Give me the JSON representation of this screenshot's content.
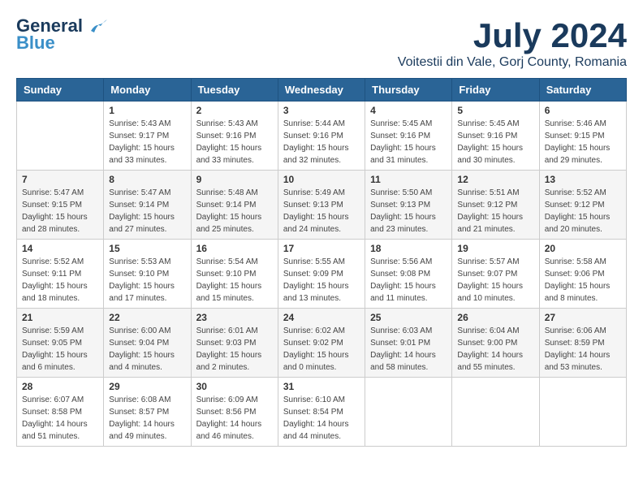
{
  "header": {
    "logo_line1": "General",
    "logo_line2": "Blue",
    "month": "July 2024",
    "location": "Voitestii din Vale, Gorj County, Romania"
  },
  "weekdays": [
    "Sunday",
    "Monday",
    "Tuesday",
    "Wednesday",
    "Thursday",
    "Friday",
    "Saturday"
  ],
  "weeks": [
    [
      {
        "day": "",
        "sunrise": "",
        "sunset": "",
        "daylight": ""
      },
      {
        "day": "1",
        "sunrise": "Sunrise: 5:43 AM",
        "sunset": "Sunset: 9:17 PM",
        "daylight": "Daylight: 15 hours and 33 minutes."
      },
      {
        "day": "2",
        "sunrise": "Sunrise: 5:43 AM",
        "sunset": "Sunset: 9:16 PM",
        "daylight": "Daylight: 15 hours and 33 minutes."
      },
      {
        "day": "3",
        "sunrise": "Sunrise: 5:44 AM",
        "sunset": "Sunset: 9:16 PM",
        "daylight": "Daylight: 15 hours and 32 minutes."
      },
      {
        "day": "4",
        "sunrise": "Sunrise: 5:45 AM",
        "sunset": "Sunset: 9:16 PM",
        "daylight": "Daylight: 15 hours and 31 minutes."
      },
      {
        "day": "5",
        "sunrise": "Sunrise: 5:45 AM",
        "sunset": "Sunset: 9:16 PM",
        "daylight": "Daylight: 15 hours and 30 minutes."
      },
      {
        "day": "6",
        "sunrise": "Sunrise: 5:46 AM",
        "sunset": "Sunset: 9:15 PM",
        "daylight": "Daylight: 15 hours and 29 minutes."
      }
    ],
    [
      {
        "day": "7",
        "sunrise": "Sunrise: 5:47 AM",
        "sunset": "Sunset: 9:15 PM",
        "daylight": "Daylight: 15 hours and 28 minutes."
      },
      {
        "day": "8",
        "sunrise": "Sunrise: 5:47 AM",
        "sunset": "Sunset: 9:14 PM",
        "daylight": "Daylight: 15 hours and 27 minutes."
      },
      {
        "day": "9",
        "sunrise": "Sunrise: 5:48 AM",
        "sunset": "Sunset: 9:14 PM",
        "daylight": "Daylight: 15 hours and 25 minutes."
      },
      {
        "day": "10",
        "sunrise": "Sunrise: 5:49 AM",
        "sunset": "Sunset: 9:13 PM",
        "daylight": "Daylight: 15 hours and 24 minutes."
      },
      {
        "day": "11",
        "sunrise": "Sunrise: 5:50 AM",
        "sunset": "Sunset: 9:13 PM",
        "daylight": "Daylight: 15 hours and 23 minutes."
      },
      {
        "day": "12",
        "sunrise": "Sunrise: 5:51 AM",
        "sunset": "Sunset: 9:12 PM",
        "daylight": "Daylight: 15 hours and 21 minutes."
      },
      {
        "day": "13",
        "sunrise": "Sunrise: 5:52 AM",
        "sunset": "Sunset: 9:12 PM",
        "daylight": "Daylight: 15 hours and 20 minutes."
      }
    ],
    [
      {
        "day": "14",
        "sunrise": "Sunrise: 5:52 AM",
        "sunset": "Sunset: 9:11 PM",
        "daylight": "Daylight: 15 hours and 18 minutes."
      },
      {
        "day": "15",
        "sunrise": "Sunrise: 5:53 AM",
        "sunset": "Sunset: 9:10 PM",
        "daylight": "Daylight: 15 hours and 17 minutes."
      },
      {
        "day": "16",
        "sunrise": "Sunrise: 5:54 AM",
        "sunset": "Sunset: 9:10 PM",
        "daylight": "Daylight: 15 hours and 15 minutes."
      },
      {
        "day": "17",
        "sunrise": "Sunrise: 5:55 AM",
        "sunset": "Sunset: 9:09 PM",
        "daylight": "Daylight: 15 hours and 13 minutes."
      },
      {
        "day": "18",
        "sunrise": "Sunrise: 5:56 AM",
        "sunset": "Sunset: 9:08 PM",
        "daylight": "Daylight: 15 hours and 11 minutes."
      },
      {
        "day": "19",
        "sunrise": "Sunrise: 5:57 AM",
        "sunset": "Sunset: 9:07 PM",
        "daylight": "Daylight: 15 hours and 10 minutes."
      },
      {
        "day": "20",
        "sunrise": "Sunrise: 5:58 AM",
        "sunset": "Sunset: 9:06 PM",
        "daylight": "Daylight: 15 hours and 8 minutes."
      }
    ],
    [
      {
        "day": "21",
        "sunrise": "Sunrise: 5:59 AM",
        "sunset": "Sunset: 9:05 PM",
        "daylight": "Daylight: 15 hours and 6 minutes."
      },
      {
        "day": "22",
        "sunrise": "Sunrise: 6:00 AM",
        "sunset": "Sunset: 9:04 PM",
        "daylight": "Daylight: 15 hours and 4 minutes."
      },
      {
        "day": "23",
        "sunrise": "Sunrise: 6:01 AM",
        "sunset": "Sunset: 9:03 PM",
        "daylight": "Daylight: 15 hours and 2 minutes."
      },
      {
        "day": "24",
        "sunrise": "Sunrise: 6:02 AM",
        "sunset": "Sunset: 9:02 PM",
        "daylight": "Daylight: 15 hours and 0 minutes."
      },
      {
        "day": "25",
        "sunrise": "Sunrise: 6:03 AM",
        "sunset": "Sunset: 9:01 PM",
        "daylight": "Daylight: 14 hours and 58 minutes."
      },
      {
        "day": "26",
        "sunrise": "Sunrise: 6:04 AM",
        "sunset": "Sunset: 9:00 PM",
        "daylight": "Daylight: 14 hours and 55 minutes."
      },
      {
        "day": "27",
        "sunrise": "Sunrise: 6:06 AM",
        "sunset": "Sunset: 8:59 PM",
        "daylight": "Daylight: 14 hours and 53 minutes."
      }
    ],
    [
      {
        "day": "28",
        "sunrise": "Sunrise: 6:07 AM",
        "sunset": "Sunset: 8:58 PM",
        "daylight": "Daylight: 14 hours and 51 minutes."
      },
      {
        "day": "29",
        "sunrise": "Sunrise: 6:08 AM",
        "sunset": "Sunset: 8:57 PM",
        "daylight": "Daylight: 14 hours and 49 minutes."
      },
      {
        "day": "30",
        "sunrise": "Sunrise: 6:09 AM",
        "sunset": "Sunset: 8:56 PM",
        "daylight": "Daylight: 14 hours and 46 minutes."
      },
      {
        "day": "31",
        "sunrise": "Sunrise: 6:10 AM",
        "sunset": "Sunset: 8:54 PM",
        "daylight": "Daylight: 14 hours and 44 minutes."
      },
      {
        "day": "",
        "sunrise": "",
        "sunset": "",
        "daylight": ""
      },
      {
        "day": "",
        "sunrise": "",
        "sunset": "",
        "daylight": ""
      },
      {
        "day": "",
        "sunrise": "",
        "sunset": "",
        "daylight": ""
      }
    ]
  ]
}
